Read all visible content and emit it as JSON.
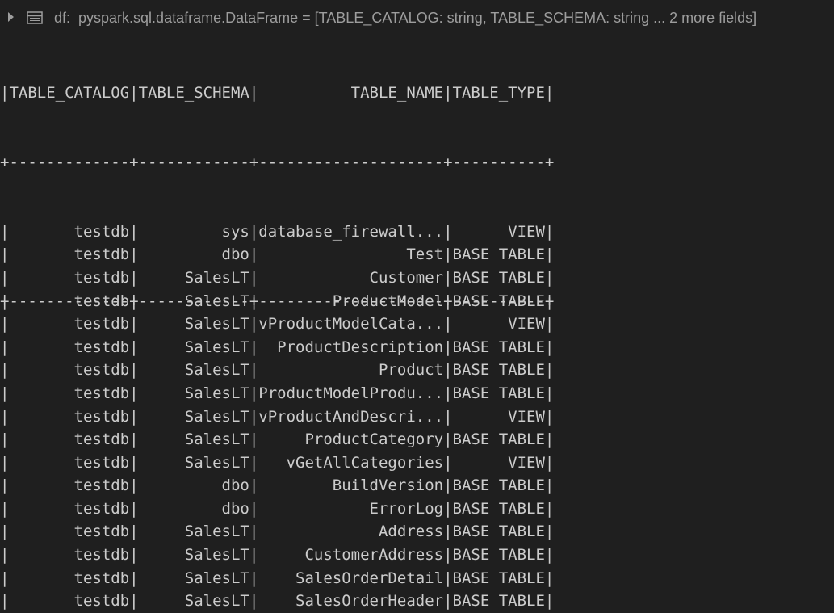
{
  "schema_bar": {
    "variable": "df:",
    "type_signature": "pyspark.sql.dataframe.DataFrame = [TABLE_CATALOG: string, TABLE_SCHEMA: string ... 2 more fields]"
  },
  "table": {
    "header": "|TABLE_CATALOG|TABLE_SCHEMA|          TABLE_NAME|TABLE_TYPE|",
    "separator": "+-------------+------------+--------------------+----------+",
    "rows": [
      "|       testdb|         sys|database_firewall...|      VIEW|",
      "|       testdb|         dbo|                Test|BASE TABLE|",
      "|       testdb|     SalesLT|            Customer|BASE TABLE|",
      "|       testdb|     SalesLT|        ProductModel|BASE TABLE|",
      "|       testdb|     SalesLT|vProductModelCata...|      VIEW|",
      "|       testdb|     SalesLT|  ProductDescription|BASE TABLE|",
      "|       testdb|     SalesLT|             Product|BASE TABLE|",
      "|       testdb|     SalesLT|ProductModelProdu...|BASE TABLE|",
      "|       testdb|     SalesLT|vProductAndDescri...|      VIEW|",
      "|       testdb|     SalesLT|     ProductCategory|BASE TABLE|",
      "|       testdb|     SalesLT|   vGetAllCategories|      VIEW|",
      "|       testdb|         dbo|        BuildVersion|BASE TABLE|",
      "|       testdb|         dbo|            ErrorLog|BASE TABLE|",
      "|       testdb|     SalesLT|             Address|BASE TABLE|",
      "|       testdb|     SalesLT|     CustomerAddress|BASE TABLE|",
      "|       testdb|     SalesLT|    SalesOrderDetail|BASE TABLE|",
      "|       testdb|     SalesLT|    SalesOrderHeader|BASE TABLE|"
    ]
  }
}
